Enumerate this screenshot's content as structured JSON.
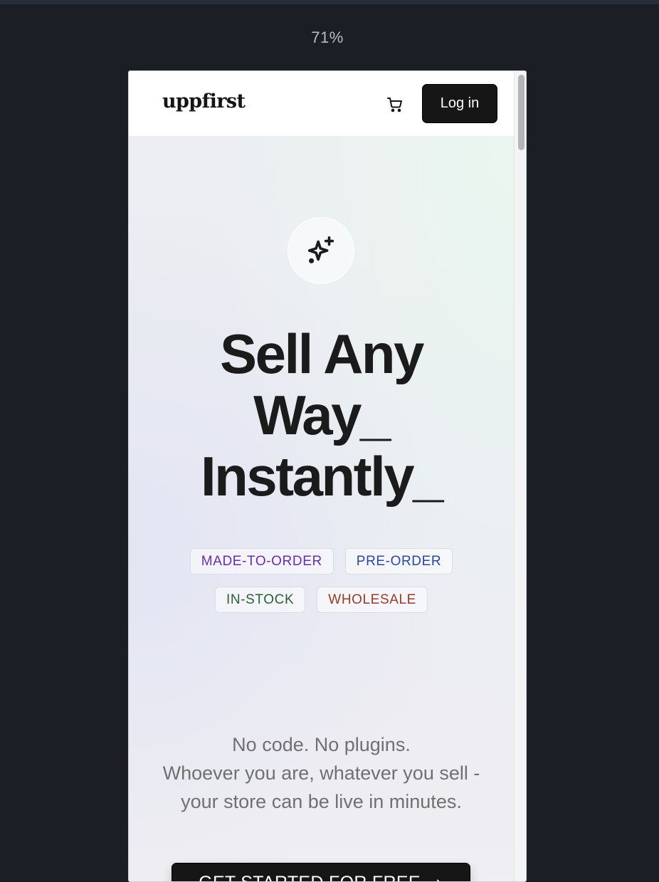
{
  "zoom": "71%",
  "navbar": {
    "logo": "uppfirst",
    "cart_icon": "cart-icon",
    "login_label": "Log in"
  },
  "hero": {
    "badge_icon": "sparkle-icon",
    "headline_lines": [
      "Sell Any",
      "Way_",
      "Instantly_"
    ],
    "tags": [
      {
        "label": "MADE-TO-ORDER",
        "color": "#6a2cae"
      },
      {
        "label": "PRE-ORDER",
        "color": "#2a47a5"
      },
      {
        "label": "IN-STOCK",
        "color": "#2a5f37"
      },
      {
        "label": "WHOLESALE",
        "color": "#9a3b23"
      }
    ],
    "subtext_lines": [
      "No code. No plugins.",
      "Whoever you are, whatever you sell -",
      "your store can be live in minutes."
    ],
    "cta_label": "GET STARTED FOR FREE",
    "cta_icon": "arrow-right-icon"
  }
}
